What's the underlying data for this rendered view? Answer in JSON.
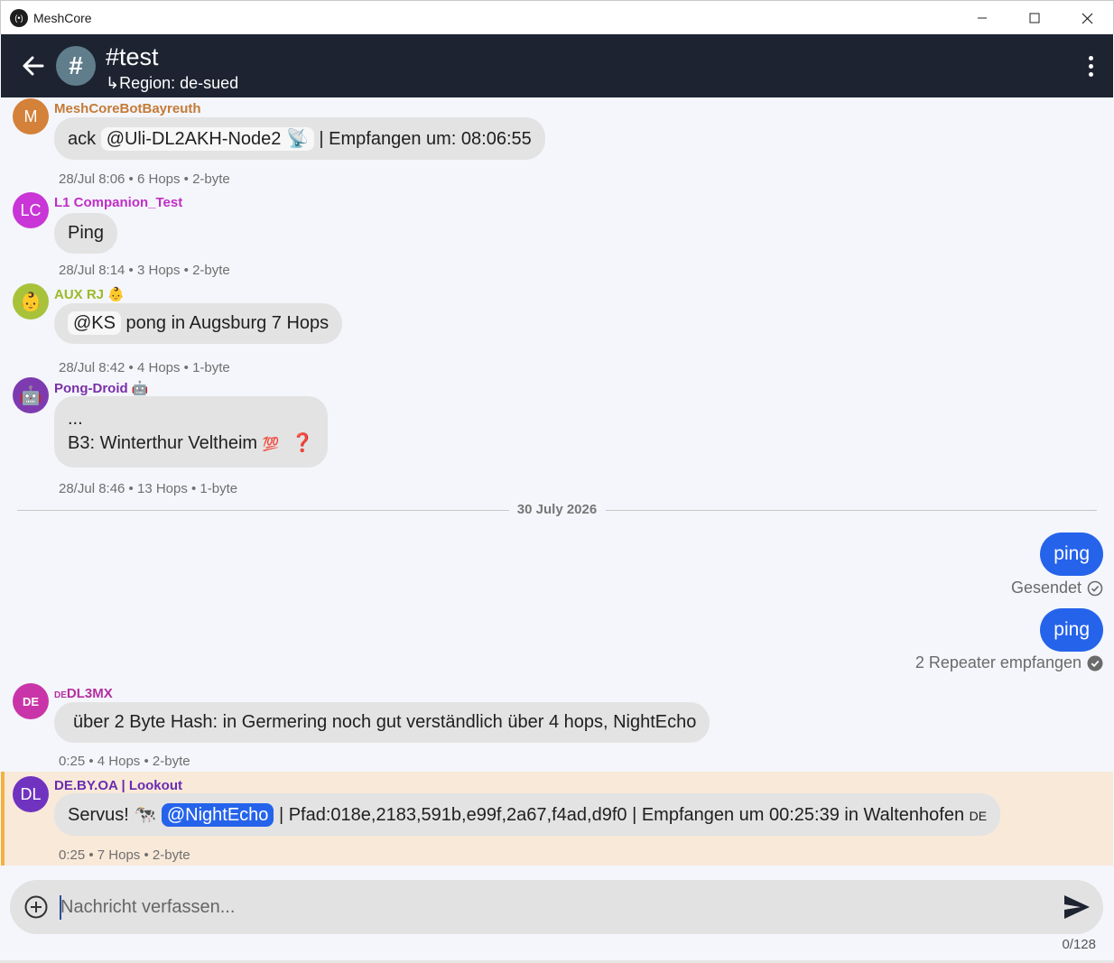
{
  "window": {
    "title": "MeshCore",
    "logo_glyph": "(•)"
  },
  "header": {
    "channel_icon": "#",
    "title": "#test",
    "region": "↳Region: de-sued"
  },
  "messages": [
    {
      "avatar": "M",
      "avatar_color": "#d4813a",
      "sender": "MeshCoreBotBayreuth",
      "sender_color": "#c57a37",
      "text_before": "ack",
      "mention": "@Uli-DL2AKH-Node2 📡",
      "text_after": "| Empfangen um: 08:06:55",
      "meta": "28/Jul 8:06 • 6 Hops • 2-byte"
    },
    {
      "avatar": "LC",
      "avatar_color": "#c935d6",
      "sender": "L1 Companion_Test",
      "sender_color": "#c02ec6",
      "text": "Ping",
      "meta": "28/Jul 8:14 • 3 Hops • 2-byte"
    },
    {
      "avatar": "👶",
      "avatar_color": "#a8c23a",
      "sender": "AUX RJ",
      "sender_emoji": "👶",
      "sender_color": "#9dba26",
      "mention": "@KS",
      "text_after": "pong in Augsburg 7 Hops",
      "meta": "28/Jul 8:42 • 4 Hops • 1-byte"
    },
    {
      "avatar": "🤖",
      "avatar_color": "#7e3bb0",
      "sender": "Pong-Droid",
      "sender_emoji": "🤖",
      "sender_color": "#7a2fa8",
      "line1": "...",
      "line2": "B3: Winterthur Veltheim",
      "line2_emoji": "💯",
      "line2_mark": "❓",
      "meta": "28/Jul 8:46 • 13 Hops • 1-byte"
    }
  ],
  "date_separator": "30 July 2026",
  "own_messages": [
    {
      "text": "ping",
      "status": "Gesendet",
      "status_icon": "check-circle-outline"
    },
    {
      "text": "ping",
      "status": "2 Repeater empfangen",
      "status_icon": "check-circle-filled"
    }
  ],
  "later_messages": [
    {
      "avatar": "DE",
      "avatar_color": "#c935a8",
      "sender_prefix": "DE",
      "sender": "DL3MX",
      "sender_color": "#b52ea0",
      "text": "über 2 Byte Hash: in Germering noch gut verständlich über 4 hops, NightEcho",
      "meta": "0:25 • 4 Hops • 2-byte"
    },
    {
      "avatar": "DL",
      "avatar_color": "#7033c0",
      "sender": "DE.BY.OA | Lookout",
      "sender_color": "#6a2cb0",
      "text_before": "Servus! 🐄",
      "mention": "@NightEcho",
      "text_after": "| Pfad:018e,2183,591b,e99f,2a67,f4ad,d9f0 | Empfangen um 00:25:39 in Waltenhofen",
      "flag": "DE",
      "meta": "0:25 • 7 Hops • 2-byte",
      "highlight_color": "#f9e9d9"
    }
  ],
  "composer": {
    "placeholder": "Nachricht verfassen...",
    "value": "",
    "counter": "0/128"
  },
  "colors": {
    "appbar": "#1d2331",
    "accent": "#2563eb",
    "bubble": "#e3e3e3",
    "background": "#f4f6fb"
  }
}
